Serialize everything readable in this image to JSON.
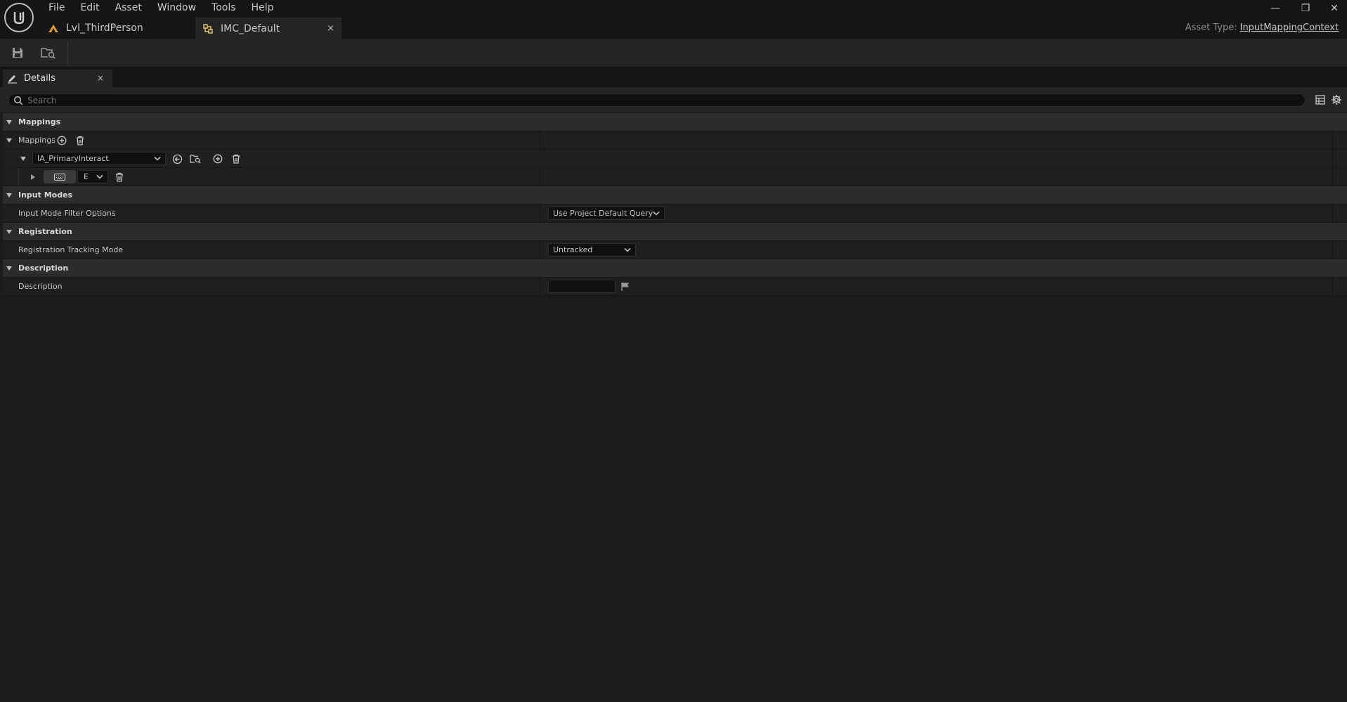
{
  "menu": [
    "File",
    "Edit",
    "Asset",
    "Window",
    "Tools",
    "Help"
  ],
  "tabs": [
    {
      "label": "Lvl_ThirdPerson",
      "icon": "level-icon"
    },
    {
      "label": "IMC_Default",
      "icon": "input-mapping-context-icon",
      "close": "×"
    }
  ],
  "window_controls": {
    "minimize": "—",
    "restore": "❐",
    "close": "✕"
  },
  "asset_type": {
    "label": "Asset Type:",
    "value": "InputMappingContext"
  },
  "toolbar": {
    "save_icon": "save-icon",
    "browse_icon": "browse-in-content-browser-icon"
  },
  "details_tab": {
    "label": "Details",
    "close": "×",
    "icon": "pencil-icon"
  },
  "search": {
    "placeholder": "Search"
  },
  "properties": {
    "mappings_category": "Mappings",
    "mappings_label": "Mappings",
    "action_value": "IA_PrimaryInteract",
    "key_value": "E",
    "input_modes_category": "Input Modes",
    "input_mode_filter_label": "Input Mode Filter Options",
    "input_mode_filter_value": "Use Project Default Query",
    "registration_category": "Registration",
    "registration_tracking_label": "Registration Tracking Mode",
    "registration_tracking_value": "Untracked",
    "description_category": "Description",
    "description_label": "Description",
    "description_value": ""
  },
  "colors": {
    "background": "#1b1b1b",
    "category_row": "#2c2c2c",
    "accent_level_icon": "#e0a030",
    "accent_imc_icon": "#e8d26a"
  }
}
